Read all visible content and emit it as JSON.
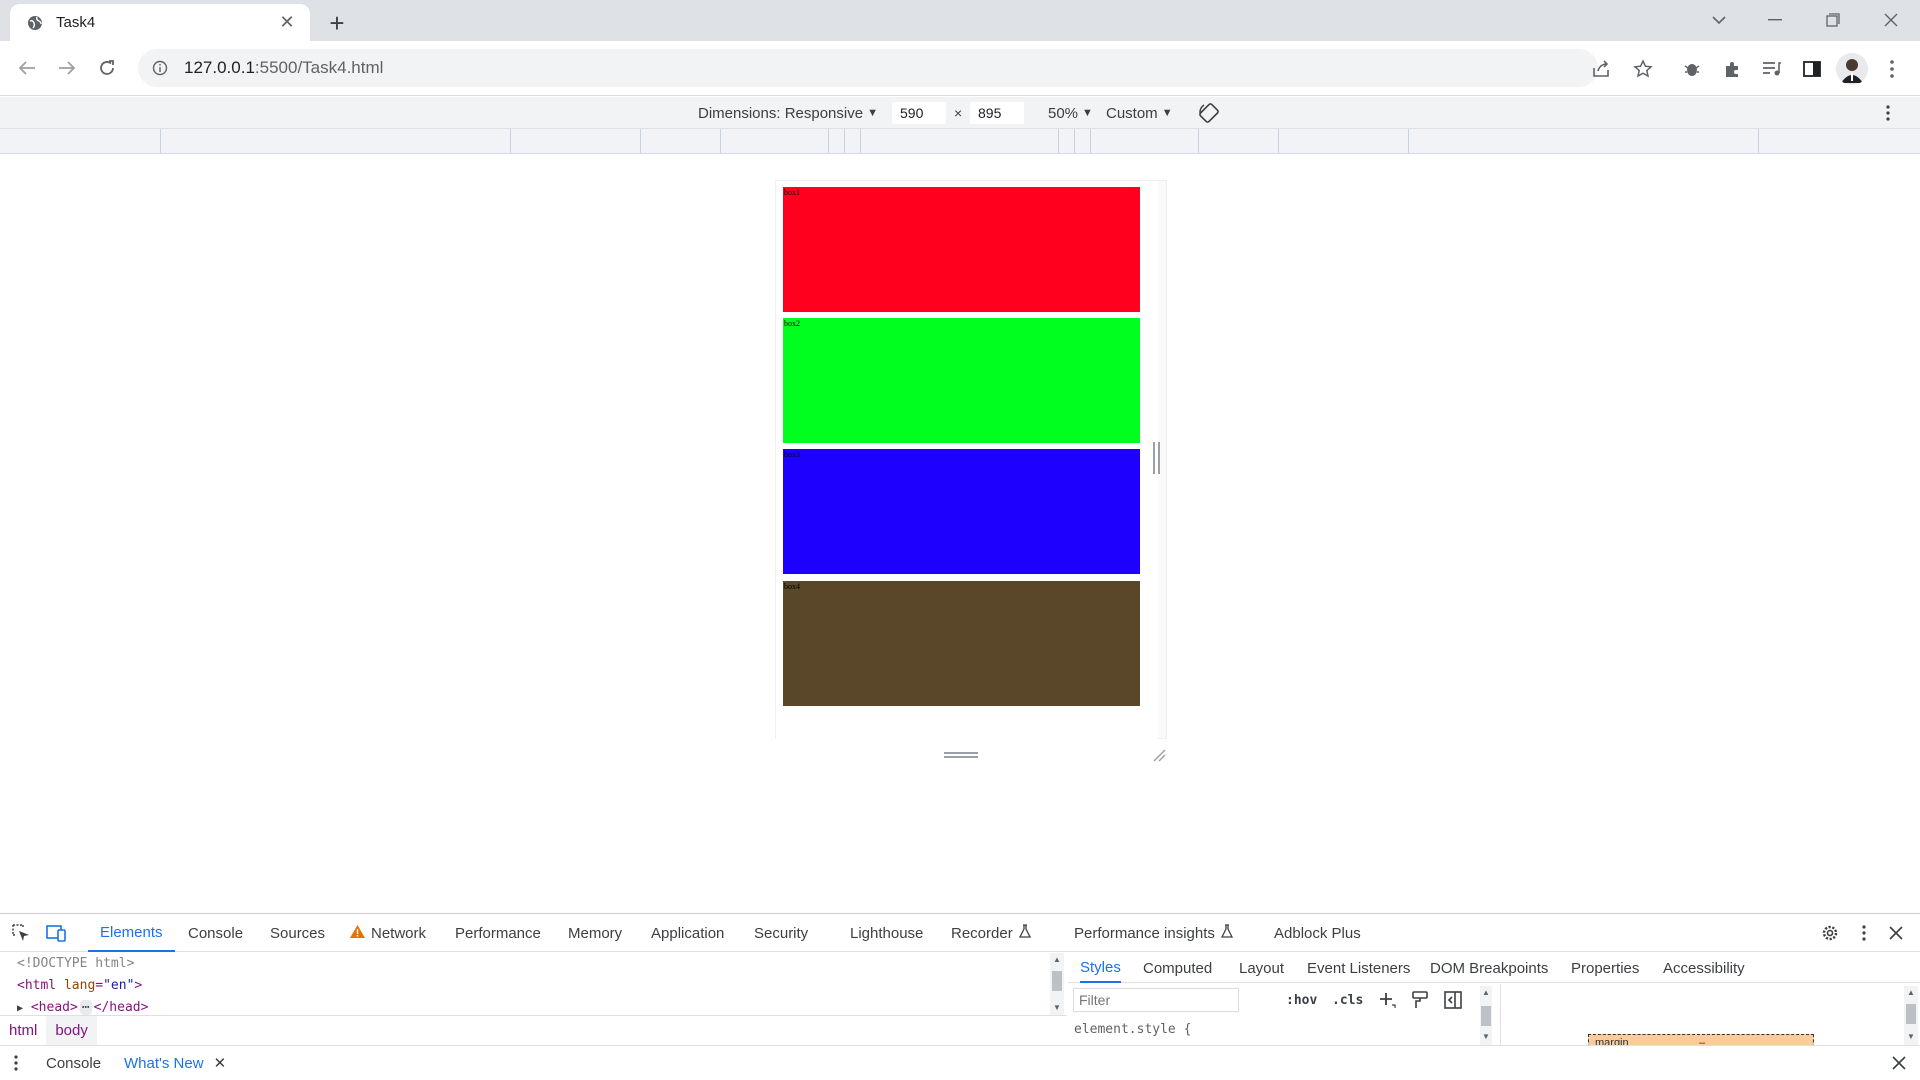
{
  "browser": {
    "tab_title": "Task4",
    "url_host": "127.0.0.1",
    "url_rest": ":5500/Task4.html"
  },
  "device_toolbar": {
    "dimensions_label": "Dimensions: Responsive",
    "width_value": "590",
    "times": "×",
    "height_value": "895",
    "zoom": "50%",
    "throttle": "Custom"
  },
  "page_boxes": [
    {
      "label": "box1",
      "color": "#ff001e"
    },
    {
      "label": "box2",
      "color": "#00ff1e"
    },
    {
      "label": "box3",
      "color": "#1e00ff"
    },
    {
      "label": "box4",
      "color": "#5a4628"
    }
  ],
  "devtools": {
    "tabs": [
      "Elements",
      "Console",
      "Sources",
      "Network",
      "Performance",
      "Memory",
      "Application",
      "Security",
      "Lighthouse",
      "Recorder",
      "Performance insights",
      "Adblock Plus"
    ],
    "elements_lines": {
      "doctype": "<!DOCTYPE html>",
      "html_open": "<html",
      "html_attr": "lang",
      "html_eq": "=",
      "html_attr_val": "\"en\"",
      "html_close_bracket": ">",
      "head_open": "<head>",
      "ellipsis": "⋯",
      "head_close": "</head>"
    },
    "breadcrumbs": [
      "html",
      "body"
    ],
    "sub_tabs": [
      "Styles",
      "Computed",
      "Layout",
      "Event Listeners",
      "DOM Breakpoints",
      "Properties",
      "Accessibility"
    ],
    "filter_placeholder": "Filter",
    "hov": ":hov",
    "cls": ".cls",
    "element_style": "element.style {",
    "margin_label": "margin",
    "margin_value": "–"
  },
  "drawer": {
    "tabs": [
      "Console",
      "What's New"
    ]
  }
}
